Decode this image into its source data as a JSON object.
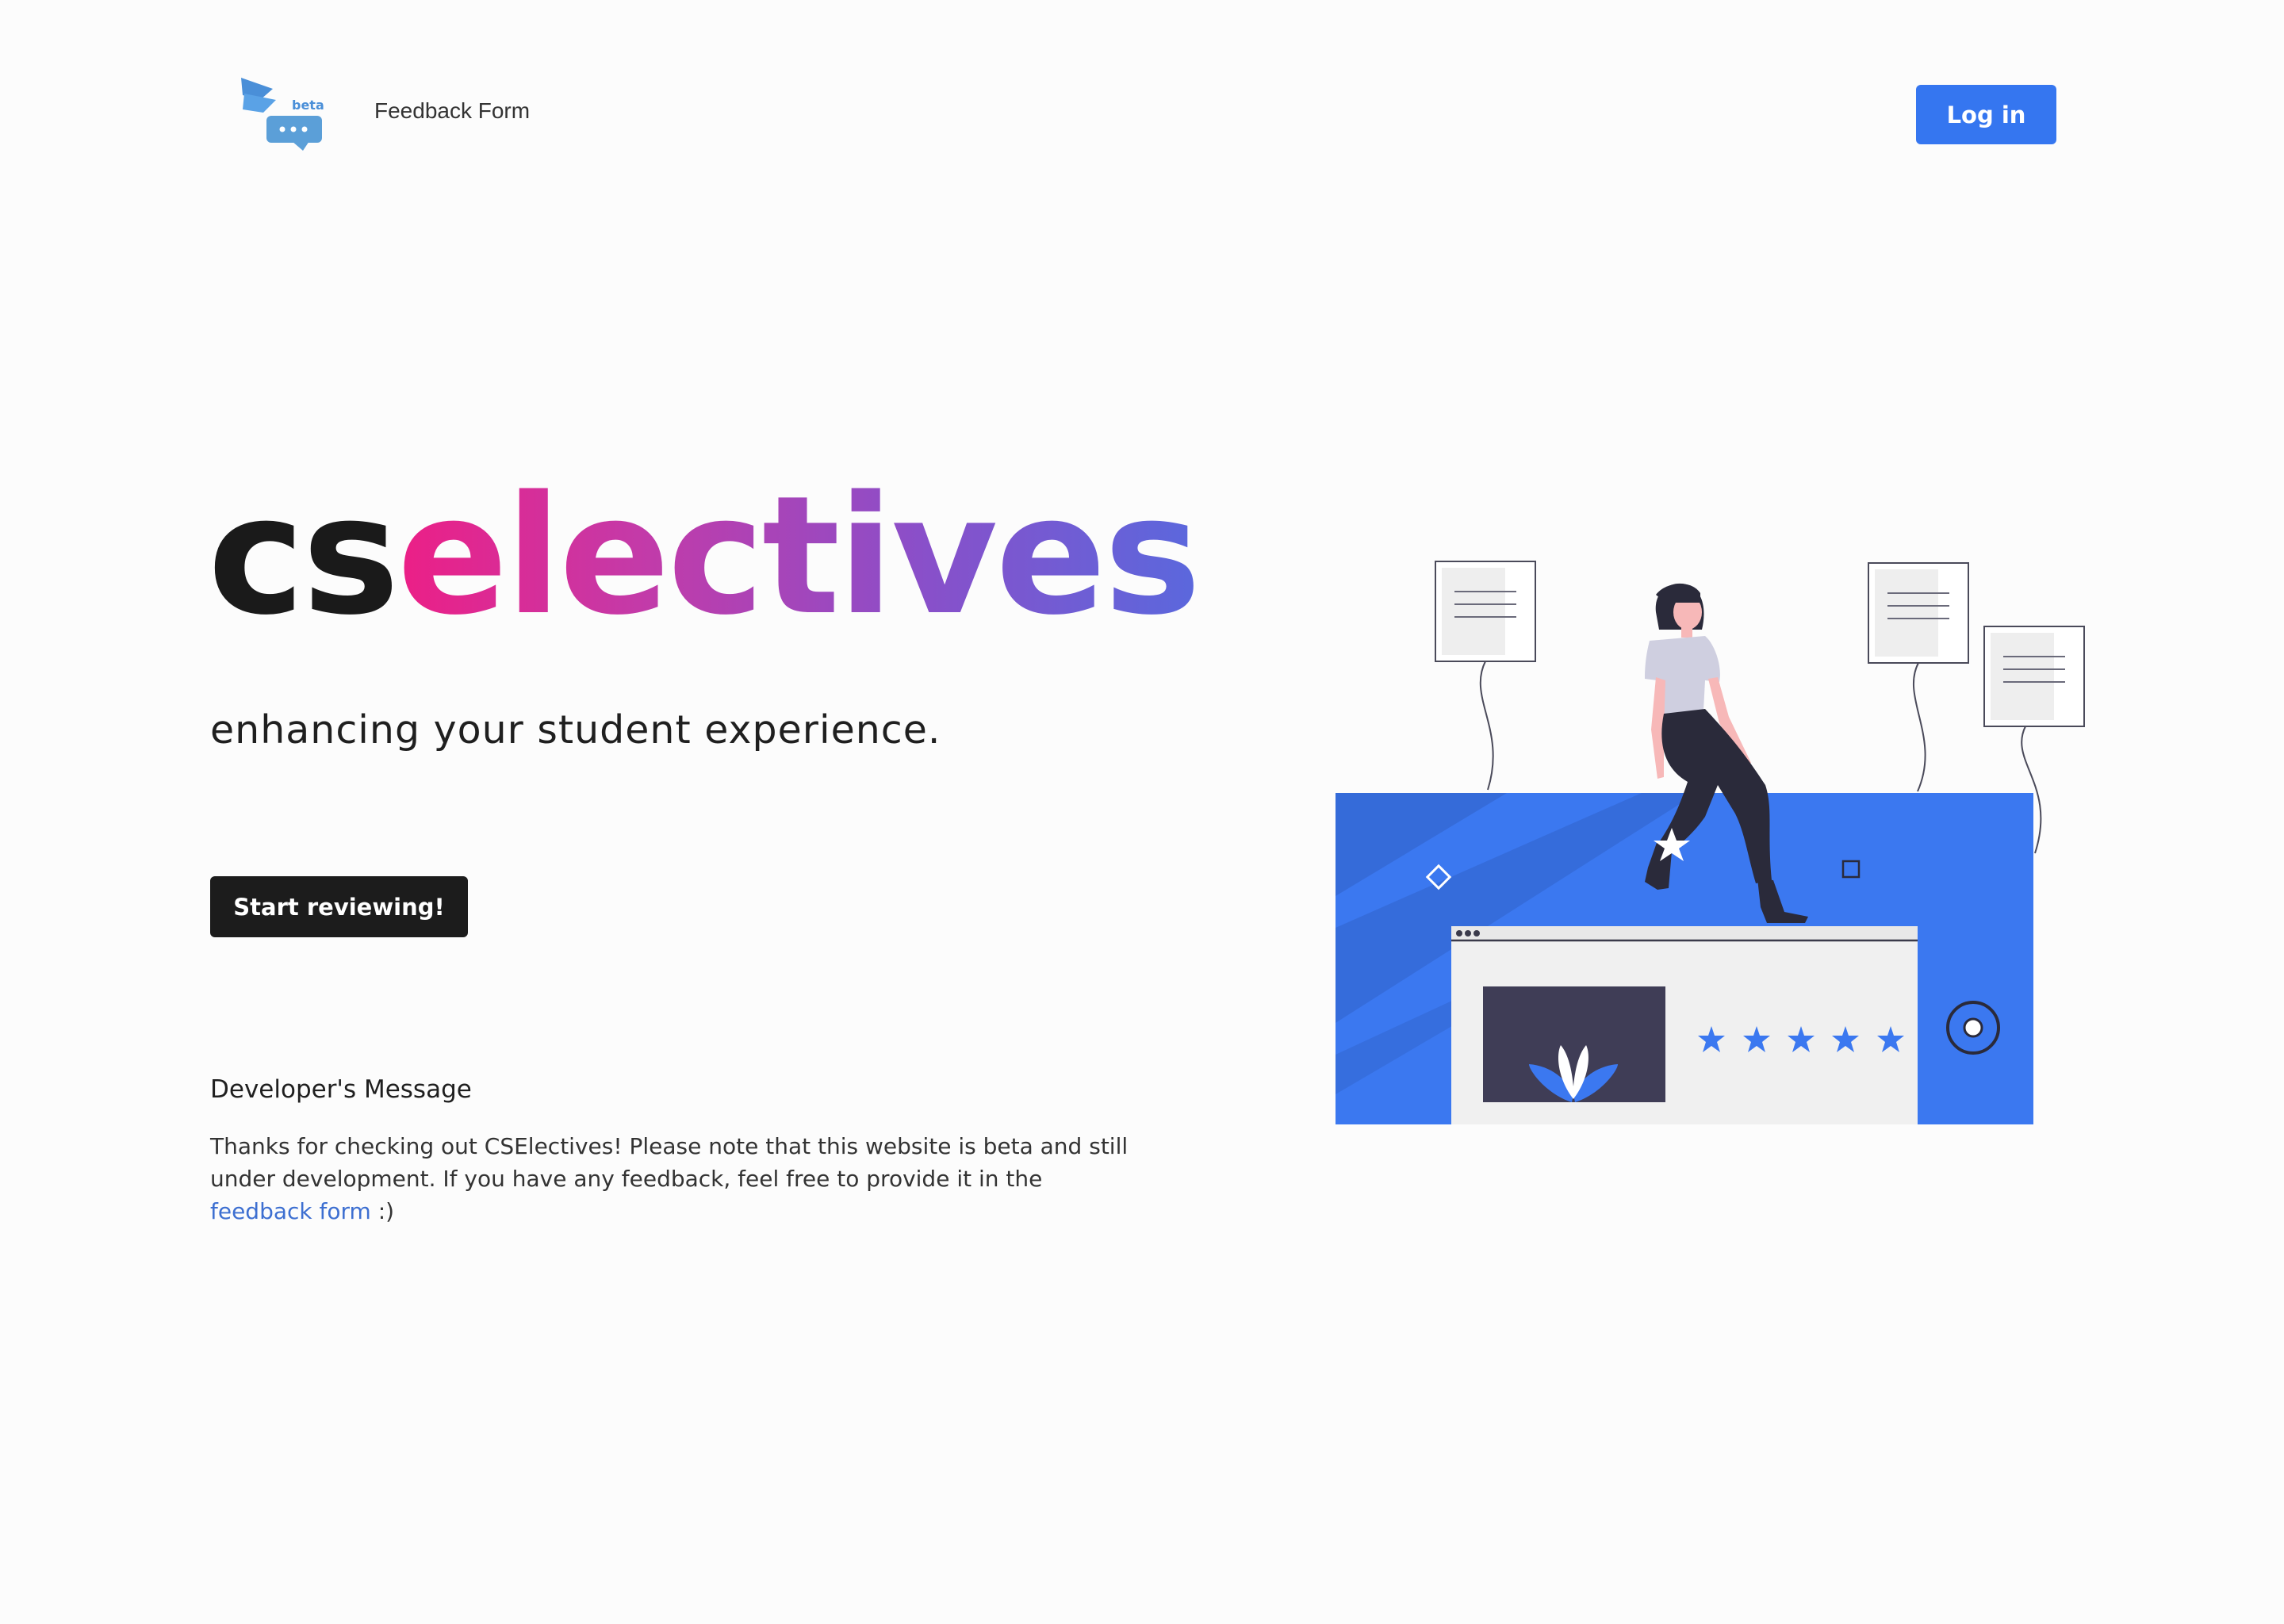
{
  "nav": {
    "logo_badge": "beta",
    "feedback_link": "Feedback Form",
    "login_label": "Log in"
  },
  "hero": {
    "brand_prefix": "cs",
    "brand_suffix": "electives",
    "tagline": "enhancing your student experience.",
    "cta_label": "Start reviewing!"
  },
  "developer_message": {
    "heading": "Developer's Message",
    "body_text": "Thanks for checking out CSElectives! Please note that this website is beta and still under development. If you have any feedback, feel free to provide it in the ",
    "link_text": "feedback form",
    "suffix": " :)"
  },
  "colors": {
    "primary_blue": "#3576f0",
    "dark_button": "#1c1c1c",
    "gradient_start": "#ec1f86",
    "gradient_end": "#5a68dd",
    "link": "#3d6fd1"
  },
  "illustration": {
    "rating_stars": 5
  }
}
